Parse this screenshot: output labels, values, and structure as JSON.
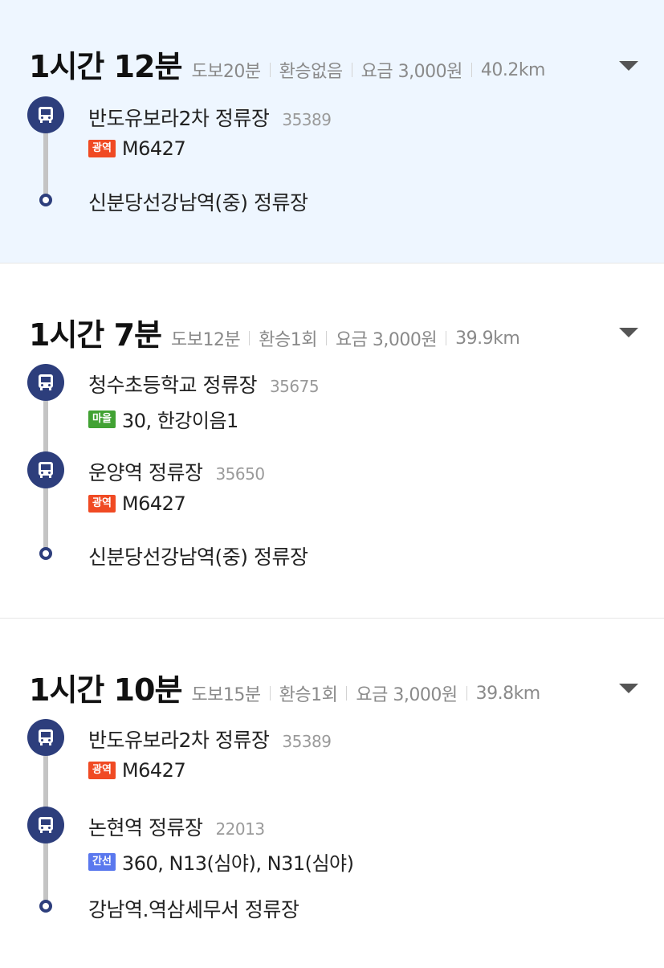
{
  "colors": {
    "selected_background": "#eef6ff",
    "stop_icon": "#2d3e7c",
    "badge_gwangyeok": "#f04a23",
    "badge_maeul": "#41a233",
    "badge_ganseon": "#5a78ee"
  },
  "icons": {
    "stop": "bus-icon",
    "destination": "destination-dot-icon",
    "expand": "chevron-down-icon"
  },
  "routes": [
    {
      "total": "1시간 12분",
      "walk": "도보20분",
      "transfer": "환승없음",
      "fare": "요금 3,000원",
      "distance": "40.2km",
      "legs": [
        {
          "stop": "반도유보라2차 정류장",
          "stop_id": "35389",
          "badge": "광역",
          "buses": "M6427"
        }
      ],
      "destination": "신분당선강남역(중) 정류장"
    },
    {
      "total": "1시간 7분",
      "walk": "도보12분",
      "transfer": "환승1회",
      "fare": "요금 3,000원",
      "distance": "39.9km",
      "legs": [
        {
          "stop": "청수초등학교 정류장",
          "stop_id": "35675",
          "badge": "마을",
          "buses": "30, 한강이음1"
        },
        {
          "stop": "운양역 정류장",
          "stop_id": "35650",
          "badge": "광역",
          "buses": "M6427"
        }
      ],
      "destination": "신분당선강남역(중) 정류장"
    },
    {
      "total": "1시간 10분",
      "walk": "도보15분",
      "transfer": "환승1회",
      "fare": "요금 3,000원",
      "distance": "39.8km",
      "legs": [
        {
          "stop": "반도유보라2차 정류장",
          "stop_id": "35389",
          "badge": "광역",
          "buses": "M6427"
        },
        {
          "stop": "논현역 정류장",
          "stop_id": "22013",
          "badge": "간선",
          "buses": "360, N13(심야), N31(심야)"
        }
      ],
      "destination": "강남역.역삼세무서 정류장"
    }
  ]
}
